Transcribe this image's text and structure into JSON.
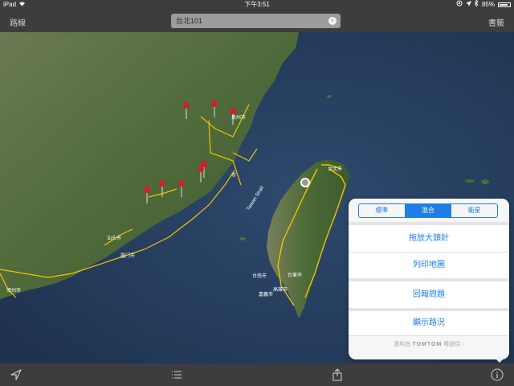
{
  "status_bar": {
    "device": "iPad",
    "time": "下午3:51",
    "battery": "85%",
    "battery_level": 0.85
  },
  "nav_bar": {
    "left_label": "路線",
    "right_label": "書籤",
    "search_value": "台北101"
  },
  "map": {
    "strait_label": "Taiwan Strait",
    "place_labels": [
      "台北市",
      "台南市",
      "嘉義市",
      "台東市",
      "高雄市",
      "汕头市",
      "泉州市",
      "厦门市",
      "漳州市",
      "市"
    ],
    "pin_color": "#d0202a",
    "road_color": "#f2c200",
    "sea_color": "#243856"
  },
  "popover": {
    "segments": [
      "標準",
      "混合",
      "衛星"
    ],
    "selected_segment": "混合",
    "actions": [
      "拖放大頭針",
      "列印地圖",
      "回報問題",
      "顯示路況"
    ],
    "credit_text": "資料由",
    "credit_brand": "TOMTOM",
    "credit_suffix": "等提供",
    "accent_color": "#1f7de6"
  },
  "toolbar": {
    "icons": [
      "location-arrow-icon",
      "list-icon",
      "share-icon",
      "info-icon"
    ]
  }
}
